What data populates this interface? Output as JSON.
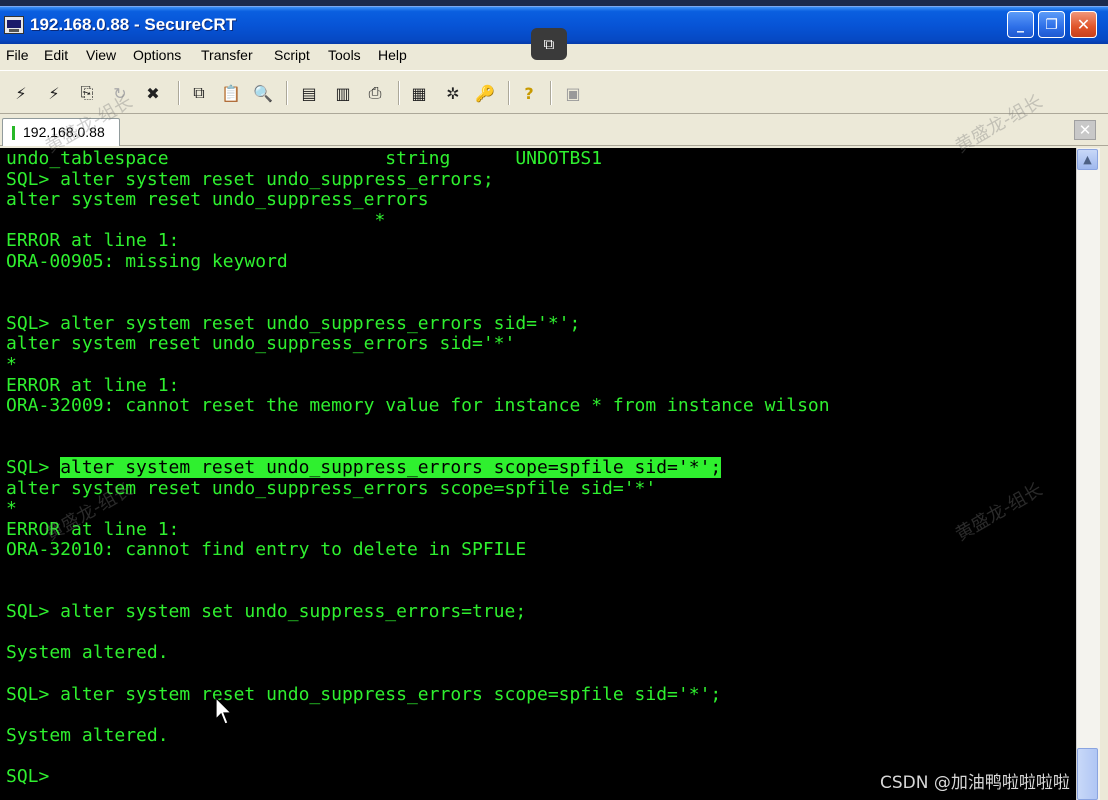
{
  "window": {
    "title": "192.168.0.88 - SecureCRT",
    "min_glyph": "_",
    "max_glyph": "❐",
    "close_glyph": "✕"
  },
  "overlay": {
    "glyph": "⧉"
  },
  "menu": [
    "File",
    "Edit",
    "View",
    "Options",
    "Transfer",
    "Script",
    "Tools",
    "Help"
  ],
  "toolbar": {
    "icons": [
      {
        "name": "connect-icon",
        "glyph": "⚡"
      },
      {
        "name": "quick-connect-icon",
        "glyph": "⚡"
      },
      {
        "name": "connect-tab-icon",
        "glyph": "⎘"
      },
      {
        "name": "reconnect-icon",
        "glyph": "↻"
      },
      {
        "name": "disconnect-icon",
        "glyph": "✖"
      },
      {
        "name": "copy-icon",
        "glyph": "⧉"
      },
      {
        "name": "paste-icon",
        "glyph": "📋"
      },
      {
        "name": "find-icon",
        "glyph": "🔍"
      },
      {
        "name": "send-icon",
        "glyph": "▤"
      },
      {
        "name": "receive-icon",
        "glyph": "▥"
      },
      {
        "name": "print-icon",
        "glyph": "⎙"
      },
      {
        "name": "session-options-icon",
        "glyph": "▦"
      },
      {
        "name": "global-options-icon",
        "glyph": "✲"
      },
      {
        "name": "keymap-icon",
        "glyph": "🔑"
      },
      {
        "name": "help-icon",
        "glyph": "?"
      },
      {
        "name": "sftp-icon",
        "glyph": "▣"
      }
    ]
  },
  "tab": {
    "label": "192.168.0.88",
    "close_glyph": "✕"
  },
  "terminal": {
    "lines": [
      {
        "text": "undo_tablespace                    string      UNDOTBS1"
      },
      {
        "text": "SQL> alter system reset undo_suppress_errors;"
      },
      {
        "text": "alter system reset undo_suppress_errors"
      },
      {
        "text": "                                  *"
      },
      {
        "text": "ERROR at line 1:"
      },
      {
        "text": "ORA-00905: missing keyword"
      },
      {
        "text": ""
      },
      {
        "text": ""
      },
      {
        "text": "SQL> alter system reset undo_suppress_errors sid='*';"
      },
      {
        "text": "alter system reset undo_suppress_errors sid='*'"
      },
      {
        "text": "*"
      },
      {
        "text": "ERROR at line 1:"
      },
      {
        "text": "ORA-32009: cannot reset the memory value for instance * from instance wilson"
      },
      {
        "text": ""
      },
      {
        "text": ""
      },
      {
        "text": "SQL> ",
        "highlight": "alter system reset undo_suppress_errors scope=spfile sid='*';"
      },
      {
        "text": "alter system reset undo_suppress_errors scope=spfile sid='*'"
      },
      {
        "text": "*"
      },
      {
        "text": "ERROR at line 1:"
      },
      {
        "text": "ORA-32010: cannot find entry to delete in SPFILE"
      },
      {
        "text": ""
      },
      {
        "text": ""
      },
      {
        "text": "SQL> alter system set undo_suppress_errors=true;"
      },
      {
        "text": ""
      },
      {
        "text": "System altered."
      },
      {
        "text": ""
      },
      {
        "text": "SQL> alter system reset undo_suppress_errors scope=spfile sid='*';"
      },
      {
        "text": ""
      },
      {
        "text": "System altered."
      },
      {
        "text": ""
      },
      {
        "text": "SQL>"
      }
    ]
  },
  "watermarks": [
    "黄盛龙-组长",
    "黄盛龙-组长",
    "黄盛龙-组长",
    "黄盛龙-组长"
  ],
  "credit": "CSDN @加油鸭啦啦啦啦"
}
